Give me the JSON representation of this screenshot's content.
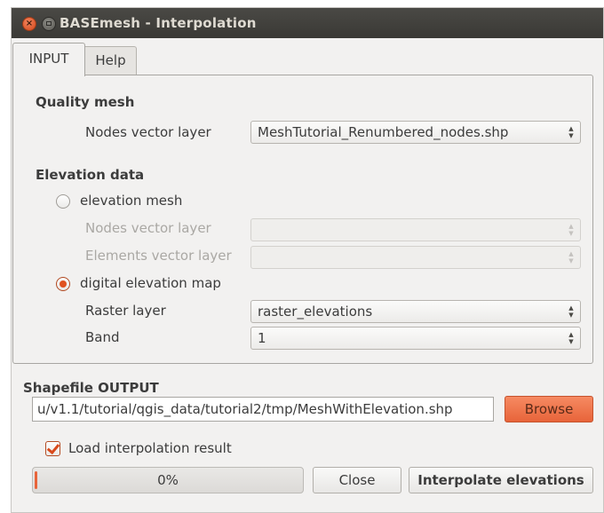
{
  "window": {
    "title": "BASEmesh - Interpolation"
  },
  "tabs": [
    {
      "label": "INPUT"
    },
    {
      "label": "Help"
    }
  ],
  "quality_mesh": {
    "title": "Quality mesh",
    "nodes_label": "Nodes vector layer",
    "nodes_value": "MeshTutorial_Renumbered_nodes.shp"
  },
  "elevation": {
    "title": "Elevation data",
    "mesh_option": {
      "label": "elevation mesh",
      "checked": false
    },
    "mesh_nodes_label": "Nodes vector layer",
    "mesh_elements_label": "Elements vector layer",
    "dem_option": {
      "label": "digital elevation map",
      "checked": true
    },
    "raster_label": "Raster layer",
    "raster_value": "raster_elevations",
    "band_label": "Band",
    "band_value": "1"
  },
  "output": {
    "title": "Shapefile OUTPUT",
    "path": "u/v1.1/tutorial/qgis_data/tutorial2/tmp/MeshWithElevation.shp",
    "browse_label": "Browse",
    "load_label": "Load interpolation result",
    "load_checked": true
  },
  "footer": {
    "progress_text": "0%",
    "progress_value": 0,
    "close_label": "Close",
    "interpolate_label": "Interpolate elevations"
  },
  "colors": {
    "accent": "#e8643a",
    "titlebar": "#3f3e3a",
    "window_bg": "#f2f1f0"
  },
  "icons": {
    "close": "close-icon",
    "minimize": "minimize-icon",
    "combo": "up-down-arrows-icon"
  }
}
